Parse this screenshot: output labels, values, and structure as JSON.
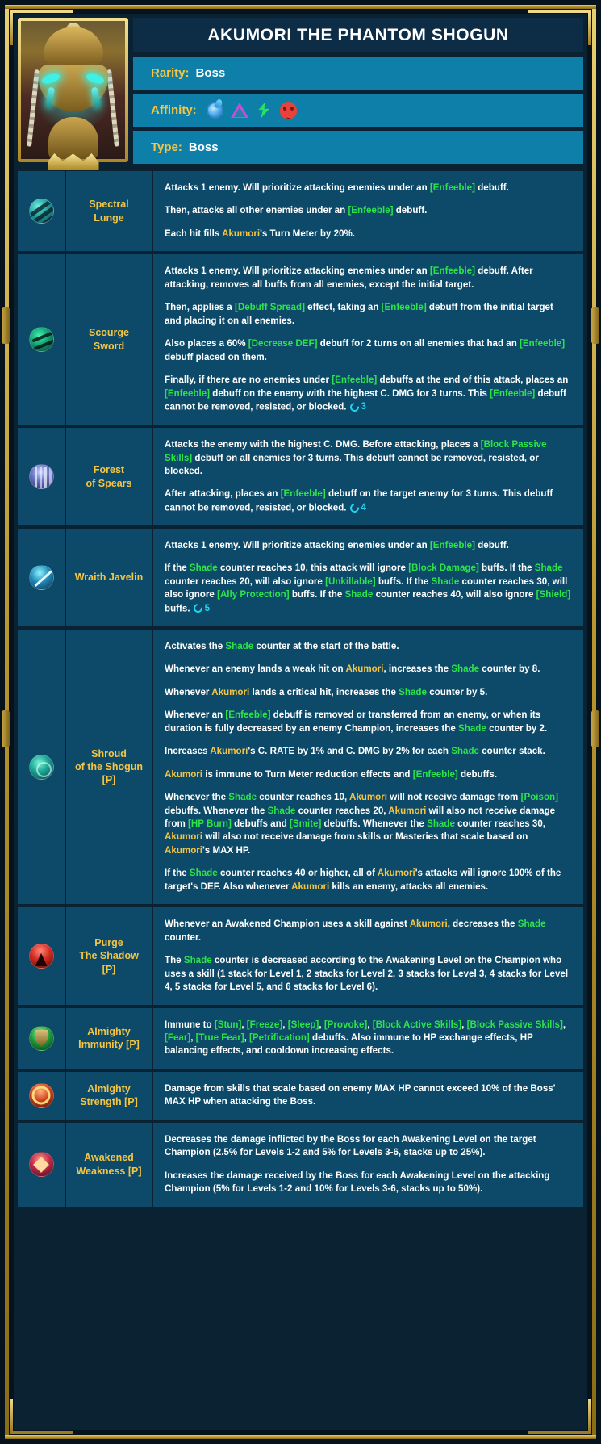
{
  "champion": {
    "title": "AKUMORI THE PHANTOM SHOGUN",
    "rarity_label": "Rarity:",
    "rarity_value": "Boss",
    "affinity_label": "Affinity:",
    "affinity_icons": [
      "magic-affinity-icon",
      "force-affinity-icon",
      "spirit-affinity-icon",
      "void-affinity-icon"
    ],
    "type_label": "Type:",
    "type_value": "Boss",
    "portrait_name": "akumori-portrait"
  },
  "colors": {
    "gold": "#f5c542",
    "buff_green": "#2de34a",
    "cooldown_cyan": "#22d3ee",
    "panel_blue": "#0d4a69",
    "header_blue": "#0d7fa8",
    "title_blue": "#0d2c46",
    "background": "#0b2233"
  },
  "skills": [
    {
      "icon": "spectral-lunge-icon",
      "name": "Spectral\nLunge",
      "paragraphs": [
        [
          {
            "t": "Attacks 1 enemy. Will prioritize attacking enemies under an ",
            "s": "p"
          },
          {
            "t": "[Enfeeble]",
            "s": "hl"
          },
          {
            "t": " debuff.",
            "s": "p"
          }
        ],
        [
          {
            "t": "Then, attacks all other enemies under an ",
            "s": "p"
          },
          {
            "t": "[Enfeeble]",
            "s": "hl"
          },
          {
            "t": " debuff.",
            "s": "p"
          }
        ],
        [
          {
            "t": "Each hit fills ",
            "s": "p"
          },
          {
            "t": "Akumori",
            "s": "nm"
          },
          {
            "t": "'s Turn Meter by 20%.",
            "s": "p"
          }
        ]
      ],
      "cooldown": null
    },
    {
      "icon": "scourge-sword-icon",
      "name": "Scourge\nSword",
      "paragraphs": [
        [
          {
            "t": "Attacks 1 enemy. Will prioritize attacking enemies under an ",
            "s": "p"
          },
          {
            "t": "[Enfeeble]",
            "s": "hl"
          },
          {
            "t": " debuff. After attacking, removes all buffs from all enemies, except the initial target.",
            "s": "p"
          }
        ],
        [
          {
            "t": "Then, applies a ",
            "s": "p"
          },
          {
            "t": "[Debuff Spread]",
            "s": "hl"
          },
          {
            "t": " effect, taking an ",
            "s": "p"
          },
          {
            "t": "[Enfeeble]",
            "s": "hl"
          },
          {
            "t": " debuff from the initial target and placing it on all enemies.",
            "s": "p"
          }
        ],
        [
          {
            "t": "Also places a 60% ",
            "s": "p"
          },
          {
            "t": "[Decrease DEF]",
            "s": "hl"
          },
          {
            "t": " debuff for 2 turns on all enemies that had an ",
            "s": "p"
          },
          {
            "t": "[Enfeeble]",
            "s": "hl"
          },
          {
            "t": " debuff placed on them.",
            "s": "p"
          }
        ],
        [
          {
            "t": "Finally, if there are no enemies under ",
            "s": "p"
          },
          {
            "t": "[Enfeeble]",
            "s": "hl"
          },
          {
            "t": " debuffs at the end of this attack, places an ",
            "s": "p"
          },
          {
            "t": "[Enfeeble]",
            "s": "hl"
          },
          {
            "t": " debuff on the enemy with the highest C. DMG for 3 turns. This ",
            "s": "p"
          },
          {
            "t": "[Enfeeble]",
            "s": "hl"
          },
          {
            "t": " debuff cannot be removed, resisted, or blocked.",
            "s": "p"
          }
        ]
      ],
      "cooldown": "3"
    },
    {
      "icon": "forest-of-spears-icon",
      "name": "Forest\nof Spears",
      "paragraphs": [
        [
          {
            "t": "Attacks the enemy with the highest C. DMG. Before attacking, places a ",
            "s": "p"
          },
          {
            "t": "[Block Passive Skills]",
            "s": "hl"
          },
          {
            "t": " debuff on all enemies for 3 turns. This debuff cannot be removed, resisted, or blocked.",
            "s": "p"
          }
        ],
        [
          {
            "t": "After attacking, places an ",
            "s": "p"
          },
          {
            "t": "[Enfeeble]",
            "s": "hl"
          },
          {
            "t": " debuff on the target enemy for 3 turns. This debuff cannot be removed, resisted, or blocked.",
            "s": "p"
          }
        ]
      ],
      "cooldown": "4"
    },
    {
      "icon": "wraith-javelin-icon",
      "name": "Wraith Javelin",
      "paragraphs": [
        [
          {
            "t": "Attacks 1 enemy. Will prioritize attacking enemies under an ",
            "s": "p"
          },
          {
            "t": "[Enfeeble]",
            "s": "hl"
          },
          {
            "t": " debuff.",
            "s": "p"
          }
        ],
        [
          {
            "t": "If the ",
            "s": "p"
          },
          {
            "t": "Shade",
            "s": "hl"
          },
          {
            "t": " counter reaches 10, this attack will ignore ",
            "s": "p"
          },
          {
            "t": "[Block Damage]",
            "s": "hl"
          },
          {
            "t": " buffs. If the ",
            "s": "p"
          },
          {
            "t": "Shade",
            "s": "hl"
          },
          {
            "t": " counter reaches 20, will also ignore ",
            "s": "p"
          },
          {
            "t": "[Unkillable]",
            "s": "hl"
          },
          {
            "t": " buffs. If the ",
            "s": "p"
          },
          {
            "t": "Shade",
            "s": "hl"
          },
          {
            "t": " counter reaches 30, will also ignore ",
            "s": "p"
          },
          {
            "t": "[Ally Protection]",
            "s": "hl"
          },
          {
            "t": " buffs. If the ",
            "s": "p"
          },
          {
            "t": "Shade",
            "s": "hl"
          },
          {
            "t": " counter reaches 40, will also ignore ",
            "s": "p"
          },
          {
            "t": "[Shield]",
            "s": "hl"
          },
          {
            "t": " buffs.",
            "s": "p"
          }
        ]
      ],
      "cooldown": "5"
    },
    {
      "icon": "shroud-of-the-shogun-icon",
      "name": "Shroud\nof the Shogun\n[P]",
      "paragraphs": [
        [
          {
            "t": "Activates the ",
            "s": "p"
          },
          {
            "t": "Shade",
            "s": "hl"
          },
          {
            "t": " counter at the start of the battle.",
            "s": "p"
          }
        ],
        [
          {
            "t": "Whenever an enemy lands a weak hit on ",
            "s": "p"
          },
          {
            "t": "Akumori",
            "s": "nm"
          },
          {
            "t": ", increases the ",
            "s": "p"
          },
          {
            "t": "Shade",
            "s": "hl"
          },
          {
            "t": " counter by 8.",
            "s": "p"
          }
        ],
        [
          {
            "t": "Whenever ",
            "s": "p"
          },
          {
            "t": "Akumori",
            "s": "nm"
          },
          {
            "t": " lands a critical hit, increases the ",
            "s": "p"
          },
          {
            "t": "Shade",
            "s": "hl"
          },
          {
            "t": " counter by 5.",
            "s": "p"
          }
        ],
        [
          {
            "t": "Whenever an ",
            "s": "p"
          },
          {
            "t": "[Enfeeble]",
            "s": "hl"
          },
          {
            "t": " debuff is removed or transferred from an enemy, or when its duration is fully decreased by an enemy Champion, increases the ",
            "s": "p"
          },
          {
            "t": "Shade",
            "s": "hl"
          },
          {
            "t": " counter by 2.",
            "s": "p"
          }
        ],
        [
          {
            "t": "Increases ",
            "s": "p"
          },
          {
            "t": "Akumori",
            "s": "nm"
          },
          {
            "t": "'s C. RATE by 1% and C. DMG by 2% for each ",
            "s": "p"
          },
          {
            "t": "Shade",
            "s": "hl"
          },
          {
            "t": " counter stack.",
            "s": "p"
          }
        ],
        [
          {
            "t": "Akumori",
            "s": "nm"
          },
          {
            "t": " is immune to Turn Meter reduction effects and ",
            "s": "p"
          },
          {
            "t": "[Enfeeble]",
            "s": "hl"
          },
          {
            "t": " debuffs.",
            "s": "p"
          }
        ],
        [
          {
            "t": "Whenever the ",
            "s": "p"
          },
          {
            "t": "Shade",
            "s": "hl"
          },
          {
            "t": " counter reaches 10, ",
            "s": "p"
          },
          {
            "t": "Akumori",
            "s": "nm"
          },
          {
            "t": " will not receive damage from ",
            "s": "p"
          },
          {
            "t": "[Poison]",
            "s": "hl"
          },
          {
            "t": " debuffs. Whenever the ",
            "s": "p"
          },
          {
            "t": "Shade",
            "s": "hl"
          },
          {
            "t": " counter reaches 20, ",
            "s": "p"
          },
          {
            "t": "Akumori",
            "s": "nm"
          },
          {
            "t": " will also not receive damage from ",
            "s": "p"
          },
          {
            "t": "[HP Burn]",
            "s": "hl"
          },
          {
            "t": " debuffs and ",
            "s": "p"
          },
          {
            "t": "[Smite]",
            "s": "hl"
          },
          {
            "t": " debuffs. Whenever the ",
            "s": "p"
          },
          {
            "t": "Shade",
            "s": "hl"
          },
          {
            "t": " counter reaches 30, ",
            "s": "p"
          },
          {
            "t": "Akumori",
            "s": "nm"
          },
          {
            "t": " will also not receive damage from skills or Masteries that scale based on ",
            "s": "p"
          },
          {
            "t": "Akumori",
            "s": "nm"
          },
          {
            "t": "'s MAX HP.",
            "s": "p"
          }
        ],
        [
          {
            "t": "If the ",
            "s": "p"
          },
          {
            "t": "Shade",
            "s": "hl"
          },
          {
            "t": " counter reaches 40 or higher, all of ",
            "s": "p"
          },
          {
            "t": "Akumori",
            "s": "nm"
          },
          {
            "t": "'s attacks will ignore 100% of the target's DEF. Also whenever ",
            "s": "p"
          },
          {
            "t": "Akumori",
            "s": "nm"
          },
          {
            "t": " kills an enemy, attacks all enemies.",
            "s": "p"
          }
        ]
      ],
      "cooldown": null
    },
    {
      "icon": "purge-the-shadow-icon",
      "name": "Purge\nThe Shadow\n[P]",
      "paragraphs": [
        [
          {
            "t": "Whenever an Awakened Champion uses a skill against ",
            "s": "p"
          },
          {
            "t": "Akumori",
            "s": "nm"
          },
          {
            "t": ", decreases the ",
            "s": "p"
          },
          {
            "t": "Shade",
            "s": "hl"
          },
          {
            "t": " counter.",
            "s": "p"
          }
        ],
        [
          {
            "t": "The ",
            "s": "p"
          },
          {
            "t": "Shade",
            "s": "hl"
          },
          {
            "t": " counter is decreased according to the Awakening Level on the Champion who uses a skill (1 stack for Level 1, 2 stacks for Level 2, 3 stacks for Level 3, 4 stacks for Level 4, 5 stacks for Level 5, and 6 stacks for Level 6).",
            "s": "p"
          }
        ]
      ],
      "cooldown": null
    },
    {
      "icon": "almighty-immunity-icon",
      "name": "Almighty\nImmunity [P]",
      "paragraphs": [
        [
          {
            "t": "Immune to ",
            "s": "p"
          },
          {
            "t": "[Stun]",
            "s": "hl"
          },
          {
            "t": ", ",
            "s": "p"
          },
          {
            "t": "[Freeze]",
            "s": "hl"
          },
          {
            "t": ", ",
            "s": "p"
          },
          {
            "t": "[Sleep]",
            "s": "hl"
          },
          {
            "t": ", ",
            "s": "p"
          },
          {
            "t": "[Provoke]",
            "s": "hl"
          },
          {
            "t": ", ",
            "s": "p"
          },
          {
            "t": "[Block Active Skills]",
            "s": "hl"
          },
          {
            "t": ", ",
            "s": "p"
          },
          {
            "t": "[Block Passive Skills]",
            "s": "hl"
          },
          {
            "t": ", ",
            "s": "p"
          },
          {
            "t": "[Fear]",
            "s": "hl"
          },
          {
            "t": ", ",
            "s": "p"
          },
          {
            "t": "[True Fear]",
            "s": "hl"
          },
          {
            "t": ", ",
            "s": "p"
          },
          {
            "t": "[Petrification]",
            "s": "hl"
          },
          {
            "t": " debuffs. Also immune to HP exchange effects, HP balancing effects, and cooldown increasing effects.",
            "s": "p"
          }
        ]
      ],
      "cooldown": null
    },
    {
      "icon": "almighty-strength-icon",
      "name": "Almighty\nStrength [P]",
      "paragraphs": [
        [
          {
            "t": "Damage from skills that scale based on enemy MAX HP cannot exceed 10% of the Boss' MAX HP when attacking the Boss.",
            "s": "p"
          }
        ]
      ],
      "cooldown": null
    },
    {
      "icon": "awakened-weakness-icon",
      "name": "Awakened\nWeakness [P]",
      "paragraphs": [
        [
          {
            "t": "Decreases the damage inflicted by the Boss for each Awakening Level on the target Champion (2.5% for Levels 1-2 and 5% for Levels 3-6, stacks up to 25%).",
            "s": "p"
          }
        ],
        [
          {
            "t": "Increases the damage received by the Boss for each Awakening Level on the attacking Champion (5% for Levels 1-2 and 10% for Levels 3-6, stacks up to 50%).",
            "s": "p"
          }
        ]
      ],
      "cooldown": null
    }
  ]
}
